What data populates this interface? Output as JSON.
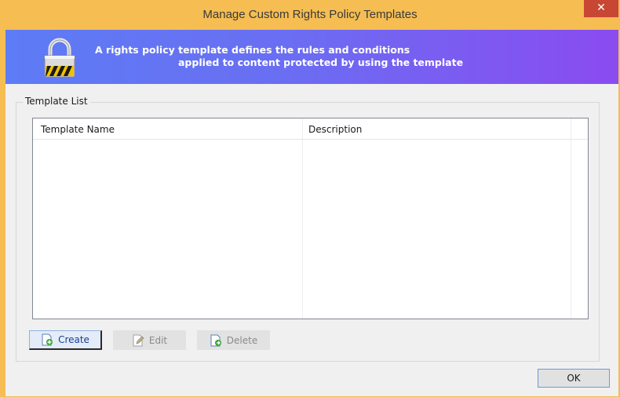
{
  "window": {
    "title": "Manage Custom Rights Policy Templates",
    "close_glyph": "✕"
  },
  "banner": {
    "line1": "A rights policy template defines the rules and conditions",
    "line2": "applied to content protected by using the template",
    "icon": "lock-icon"
  },
  "template_list": {
    "group_label": "Template List",
    "columns": [
      "Template Name",
      "Description"
    ],
    "rows": []
  },
  "buttons": {
    "create": "Create",
    "edit": "Edit",
    "delete": "Delete",
    "ok": "OK"
  },
  "colors": {
    "title_bar": "#f5bd52",
    "banner_start": "#5d7cf5",
    "banner_end": "#8a4bf0",
    "close_button": "#c74634"
  }
}
